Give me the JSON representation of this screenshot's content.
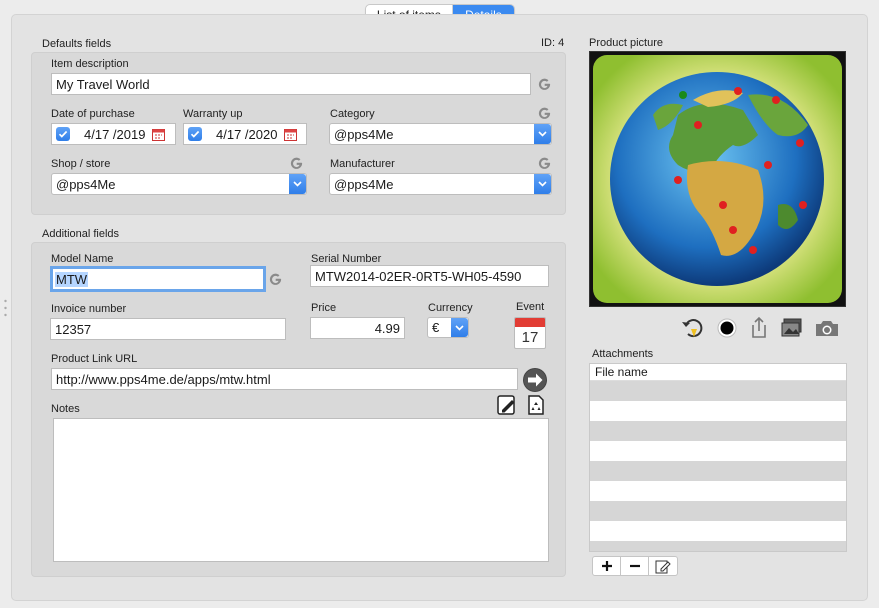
{
  "tabs": [
    {
      "label": "List of items",
      "selected": false
    },
    {
      "label": "Details",
      "selected": true
    }
  ],
  "defaults": {
    "section_title": "Defaults fields",
    "id_label": "ID: 4",
    "item_description": {
      "label": "Item description",
      "value": "My Travel World"
    },
    "date_of_purchase": {
      "label": "Date of purchase",
      "value": "4/17 /2019",
      "checked": true
    },
    "warranty_up": {
      "label": "Warranty up",
      "value": "4/17 /2020",
      "checked": true
    },
    "category": {
      "label": "Category",
      "value": "@pps4Me"
    },
    "shop": {
      "label": "Shop / store",
      "value": "@pps4Me"
    },
    "manufacturer": {
      "label": "Manufacturer",
      "value": "@pps4Me"
    }
  },
  "additional": {
    "section_title": "Additional fields",
    "model_name": {
      "label": "Model Name",
      "value": "MTW"
    },
    "serial_number": {
      "label": "Serial Number",
      "value": "MTW2014-02ER-0RT5-WH05-4590"
    },
    "invoice_number": {
      "label": "Invoice number",
      "value": "12357"
    },
    "price": {
      "label": "Price",
      "value": "4.99"
    },
    "currency": {
      "label": "Currency",
      "value": "€"
    },
    "event": {
      "label": "Event",
      "day": "17"
    },
    "product_link": {
      "label": "Product Link URL",
      "value": "http://www.pps4me.de/apps/mtw.html"
    },
    "notes": {
      "label": "Notes",
      "value": ""
    }
  },
  "picture": {
    "title": "Product picture",
    "toolbar_icons": [
      "rotate-icon",
      "circle-icon",
      "share-icon",
      "photos-icon",
      "camera-icon"
    ]
  },
  "attachments": {
    "title": "Attachments",
    "column_header": "File name",
    "rows": [
      "",
      "",
      "",
      "",
      "",
      "",
      "",
      "",
      ""
    ],
    "buttons": [
      "add-icon",
      "remove-icon",
      "edit-icon"
    ]
  },
  "colors": {
    "accent": "#3b8af0",
    "focus_ring": "#6aa5ea"
  }
}
